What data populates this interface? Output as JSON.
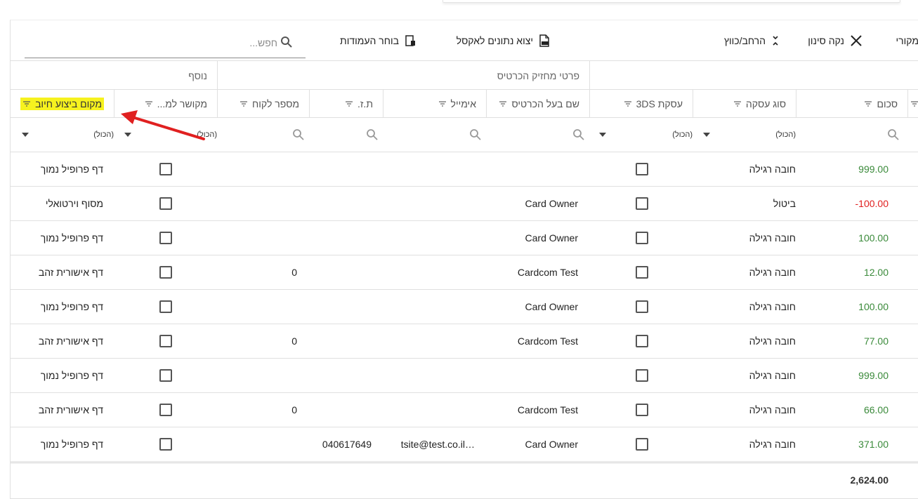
{
  "toolbar": {
    "original_label": "מקורי",
    "clear_filter_label": "נקה סינון",
    "expand_collapse_label": "הרחב/כווץ",
    "export_excel_label": "יצוא נתונים לאקסל",
    "column_chooser_label": "בוחר העמודות",
    "search_placeholder": "חפש..."
  },
  "column_groups": {
    "card_holder_details": "פרטי מחזיק הכרטיס",
    "extra": "נוסף"
  },
  "columns": {
    "amount": "סכום",
    "deal_type": "סוג עסקה",
    "deal_3ds": "עסקת 3DS",
    "card_owner_name": "שם בעל הכרטיס",
    "email": "אימייל",
    "id_number": "ת.ז.",
    "customer_number": "מספר לקוח",
    "linked_to": "מקושר למ...",
    "charge_location": "מקום ביצוע חיוב"
  },
  "filters": {
    "all_label": "(הכול)"
  },
  "rows": [
    {
      "amount": "999.00",
      "sign": "pos",
      "deal_type": "חובה רגילה",
      "owner": "",
      "email": "",
      "id": "",
      "customer": "",
      "location": "דף פרופיל נמוך"
    },
    {
      "amount": "-100.00",
      "sign": "neg",
      "deal_type": "ביטול",
      "owner": "Card Owner",
      "email": "",
      "id": "",
      "customer": "",
      "location": "מסוף וירטואלי"
    },
    {
      "amount": "100.00",
      "sign": "pos",
      "deal_type": "חובה רגילה",
      "owner": "Card Owner",
      "email": "",
      "id": "",
      "customer": "",
      "location": "דף פרופיל נמוך"
    },
    {
      "amount": "12.00",
      "sign": "pos",
      "deal_type": "חובה רגילה",
      "owner": "Cardcom Test",
      "email": "",
      "id": "",
      "customer": "0",
      "location": "דף אישורית זהב"
    },
    {
      "amount": "100.00",
      "sign": "pos",
      "deal_type": "חובה רגילה",
      "owner": "Card Owner",
      "email": "",
      "id": "",
      "customer": "",
      "location": "דף פרופיל נמוך"
    },
    {
      "amount": "77.00",
      "sign": "pos",
      "deal_type": "חובה רגילה",
      "owner": "Cardcom Test",
      "email": "",
      "id": "",
      "customer": "0",
      "location": "דף אישורית זהב"
    },
    {
      "amount": "999.00",
      "sign": "pos",
      "deal_type": "חובה רגילה",
      "owner": "",
      "email": "",
      "id": "",
      "customer": "",
      "location": "דף פרופיל נמוך"
    },
    {
      "amount": "66.00",
      "sign": "pos",
      "deal_type": "חובה רגילה",
      "owner": "Cardcom Test",
      "email": "",
      "id": "",
      "customer": "0",
      "location": "דף אישורית זהב"
    },
    {
      "amount": "371.00",
      "sign": "pos",
      "deal_type": "חובה רגילה",
      "owner": "Card Owner",
      "email": "tsite@test.co.il…",
      "id": "040617649",
      "customer": "",
      "location": "דף פרופיל נמוך"
    }
  ],
  "footer": {
    "total": "2,624.00"
  },
  "colors": {
    "positive": "#3a8a3a",
    "negative": "#e02020",
    "highlight": "#f6f21f",
    "arrow": "#e02020"
  }
}
